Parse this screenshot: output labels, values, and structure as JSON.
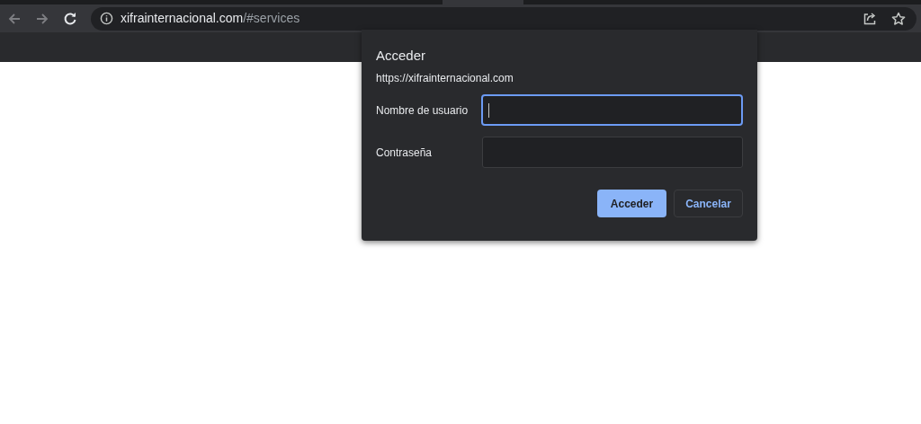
{
  "address_bar": {
    "host": "xifrainternacional.com",
    "path": "/#services"
  },
  "dialog": {
    "title": "Acceder",
    "origin": "https://xifrainternacional.com",
    "fields": [
      {
        "label": "Nombre de usuario",
        "focused": true
      },
      {
        "label": "Contraseña",
        "focused": false
      }
    ],
    "buttons": [
      {
        "label": "Acceder",
        "kind": "primary"
      },
      {
        "label": "Cancelar",
        "kind": "secondary"
      }
    ]
  }
}
